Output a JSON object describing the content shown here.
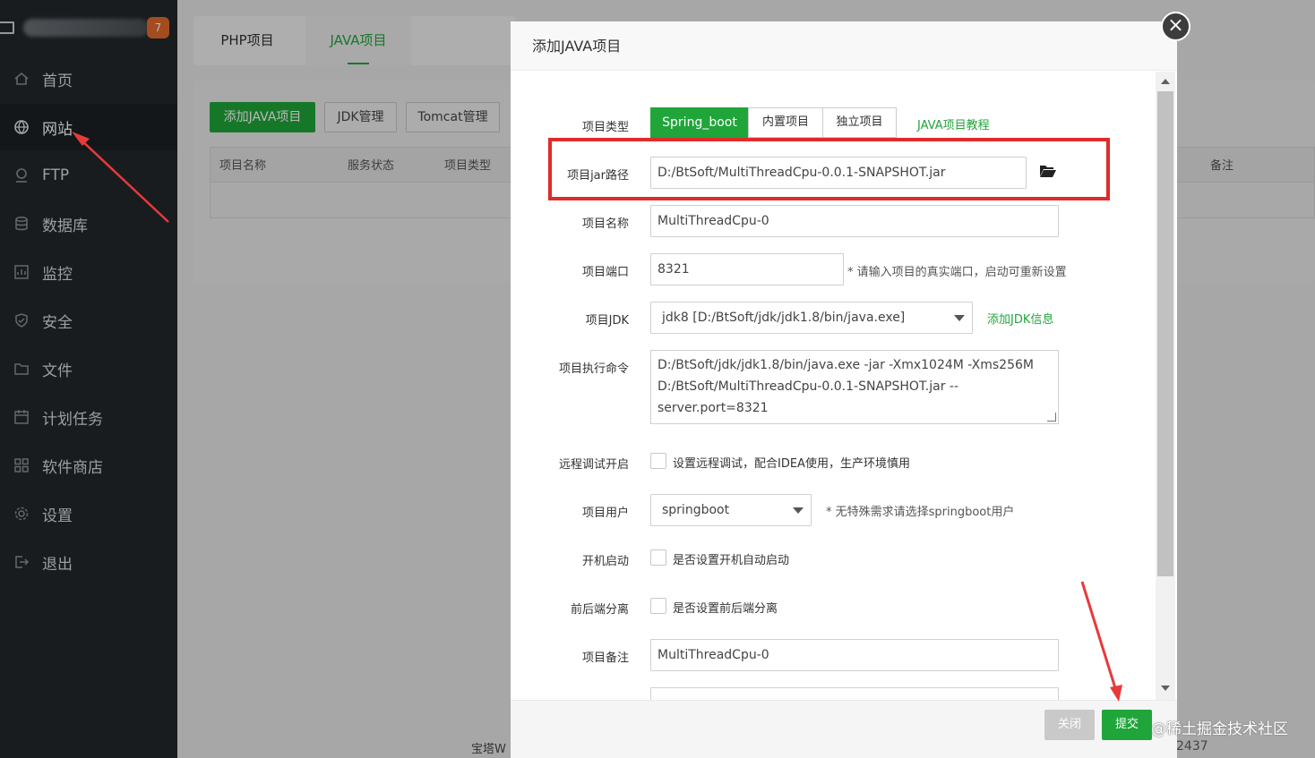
{
  "sidebar": {
    "badge": "7",
    "items": [
      {
        "label": "首页",
        "icon": "home-icon"
      },
      {
        "label": "网站",
        "icon": "globe-icon"
      },
      {
        "label": "FTP",
        "icon": "ftp-icon"
      },
      {
        "label": "数据库",
        "icon": "database-icon"
      },
      {
        "label": "监控",
        "icon": "monitor-icon"
      },
      {
        "label": "安全",
        "icon": "shield-icon"
      },
      {
        "label": "文件",
        "icon": "folder-icon"
      },
      {
        "label": "计划任务",
        "icon": "calendar-icon"
      },
      {
        "label": "软件商店",
        "icon": "grid-icon"
      },
      {
        "label": "设置",
        "icon": "gear-icon"
      },
      {
        "label": "退出",
        "icon": "logout-icon"
      }
    ]
  },
  "tabs": {
    "php": "PHP项目",
    "java": "JAVA项目"
  },
  "toolbar": {
    "add": "添加JAVA项目",
    "jdk": "JDK管理",
    "tomcat": "Tomcat管理"
  },
  "table": {
    "headers": [
      "项目名称",
      "服务状态",
      "项目类型",
      "备注"
    ]
  },
  "footer": {
    "text": "宝塔W",
    "trailing": "2437"
  },
  "modal": {
    "title": "添加JAVA项目",
    "close": "×",
    "type_label": "项目类型",
    "types": [
      "Spring_boot",
      "内置项目",
      "独立项目"
    ],
    "tutorial_link": "JAVA项目教程",
    "jar_label": "项目jar路径",
    "jar_value": "D:/BtSoft/MultiThreadCpu-0.0.1-SNAPSHOT.jar",
    "name_label": "项目名称",
    "name_value": "MultiThreadCpu-0",
    "port_label": "项目端口",
    "port_value": "8321",
    "port_hint": "* 请输入项目的真实端口，启动可重新设置",
    "jdk_label": "项目JDK",
    "jdk_value": "jdk8 [D:/BtSoft/jdk/jdk1.8/bin/java.exe]",
    "add_jdk_link": "添加JDK信息",
    "cmd_label": "项目执行命令",
    "cmd_lines": [
      "D:/BtSoft/jdk/jdk1.8/bin/java.exe -jar -Xmx1024M -Xms256M",
      "D:/BtSoft/MultiThreadCpu-0.0.1-SNAPSHOT.jar --",
      "server.port=8321"
    ],
    "debug_label": "远程调试开启",
    "debug_text": "设置远程调试，配合IDEA使用，生产环境慎用",
    "user_label": "项目用户",
    "user_value": "springboot",
    "user_hint": "* 无特殊需求请选择springboot用户",
    "boot_label": "开机启动",
    "boot_text": "是否设置开机自动启动",
    "sep_label": "前后端分离",
    "sep_text": "是否设置前后端分离",
    "remark_label": "项目备注",
    "remark_value": "MultiThreadCpu-0",
    "close_btn": "关闭",
    "submit_btn": "提交"
  },
  "watermark": "@稀土掘金技术社区",
  "colors": {
    "accent": "#20a53a",
    "highlight": "#e02b2b",
    "sidebar": "#23272b"
  }
}
